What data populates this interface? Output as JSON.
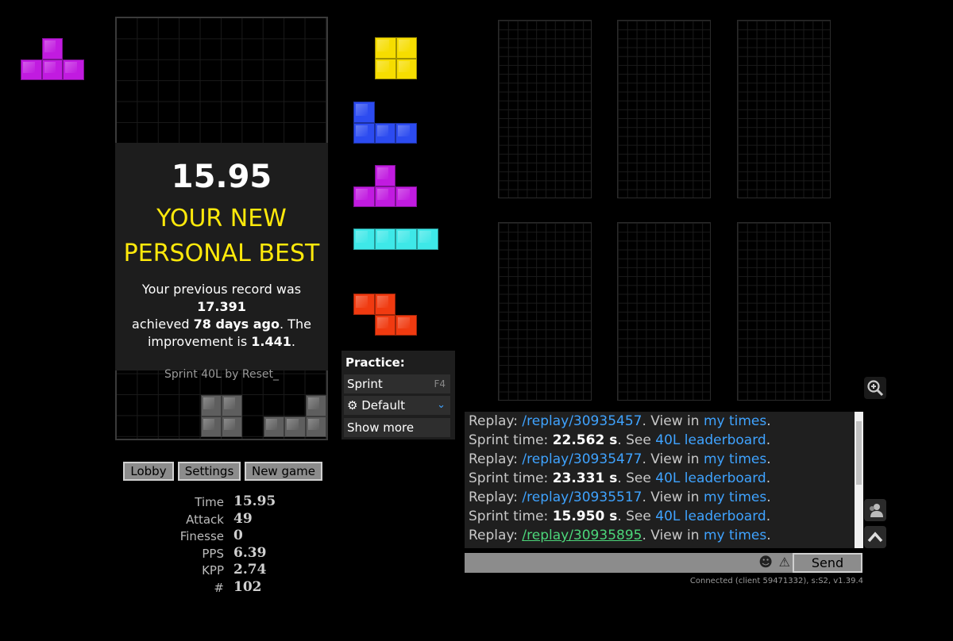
{
  "hold_piece": "T",
  "next_queue": [
    "O",
    "J",
    "T",
    "I",
    "Z"
  ],
  "colors": {
    "T": "#c11be0",
    "O": "#f6dd00",
    "J": "#2c4bf0",
    "I": "#3ee8e8",
    "Z": "#f03a10",
    "garbage": "#5e5e5e",
    "pb_yellow": "#ffe90b",
    "link_blue": "#3fa3ff",
    "link_visited": "#4cd67a"
  },
  "result": {
    "time": "15.95",
    "headline_line1": "YOUR NEW",
    "headline_line2": "PERSONAL BEST",
    "prev_text_1": "Your previous record was ",
    "prev_record": "17.391",
    "prev_text_2": "achieved ",
    "days_ago": "78 days ago",
    "prev_text_3": ". The",
    "prev_text_4": "improvement is ",
    "improvement": "1.441",
    "prev_text_5": ".",
    "mode": "Sprint 40L by Reset_"
  },
  "buttons": {
    "lobby": "Lobby",
    "settings": "Settings",
    "new_game": "New game"
  },
  "stats": [
    {
      "label": "Time",
      "value": "15.95"
    },
    {
      "label": "Attack",
      "value": "49"
    },
    {
      "label": "Finesse",
      "value": "0"
    },
    {
      "label": "PPS",
      "value": "6.39"
    },
    {
      "label": "KPP",
      "value": "2.74"
    },
    {
      "label": "#",
      "value": "102"
    }
  ],
  "practice": {
    "title": "Practice:",
    "sprint": "Sprint",
    "sprint_key": "F4",
    "default": "Default",
    "show_more": "Show more"
  },
  "chat": [
    {
      "type": "replay",
      "prefix": "Replay: ",
      "link": "/replay/30935457",
      "mid": ". View in ",
      "link2": "my times",
      "suffix": "."
    },
    {
      "type": "sprint",
      "prefix": "Sprint time: ",
      "bold": "22.562 s",
      "mid": ". See ",
      "link": "40L leaderboard",
      "suffix": "."
    },
    {
      "type": "replay",
      "prefix": "Replay: ",
      "link": "/replay/30935477",
      "mid": ". View in ",
      "link2": "my times",
      "suffix": "."
    },
    {
      "type": "sprint",
      "prefix": "Sprint time: ",
      "bold": "23.331 s",
      "mid": ". See ",
      "link": "40L leaderboard",
      "suffix": "."
    },
    {
      "type": "replay",
      "prefix": "Replay: ",
      "link": "/replay/30935517",
      "mid": ". View in ",
      "link2": "my times",
      "suffix": "."
    },
    {
      "type": "sprint",
      "prefix": "Sprint time: ",
      "bold": "15.950 s",
      "mid": ". See ",
      "link": "40L leaderboard",
      "suffix": "."
    },
    {
      "type": "replay",
      "prefix": "Replay: ",
      "link": "/replay/30935895",
      "mid": ". View in ",
      "link2": "my times",
      "suffix": ".",
      "visited": true
    }
  ],
  "send_label": "Send",
  "status": "Connected (client 59471332), s:S2, v1.39.4",
  "icons": [
    "zoom-in-icon",
    "users-icon",
    "chevron-up-icon",
    "emoji-icon",
    "warning-icon",
    "gear-icon",
    "chevron-down-icon"
  ]
}
